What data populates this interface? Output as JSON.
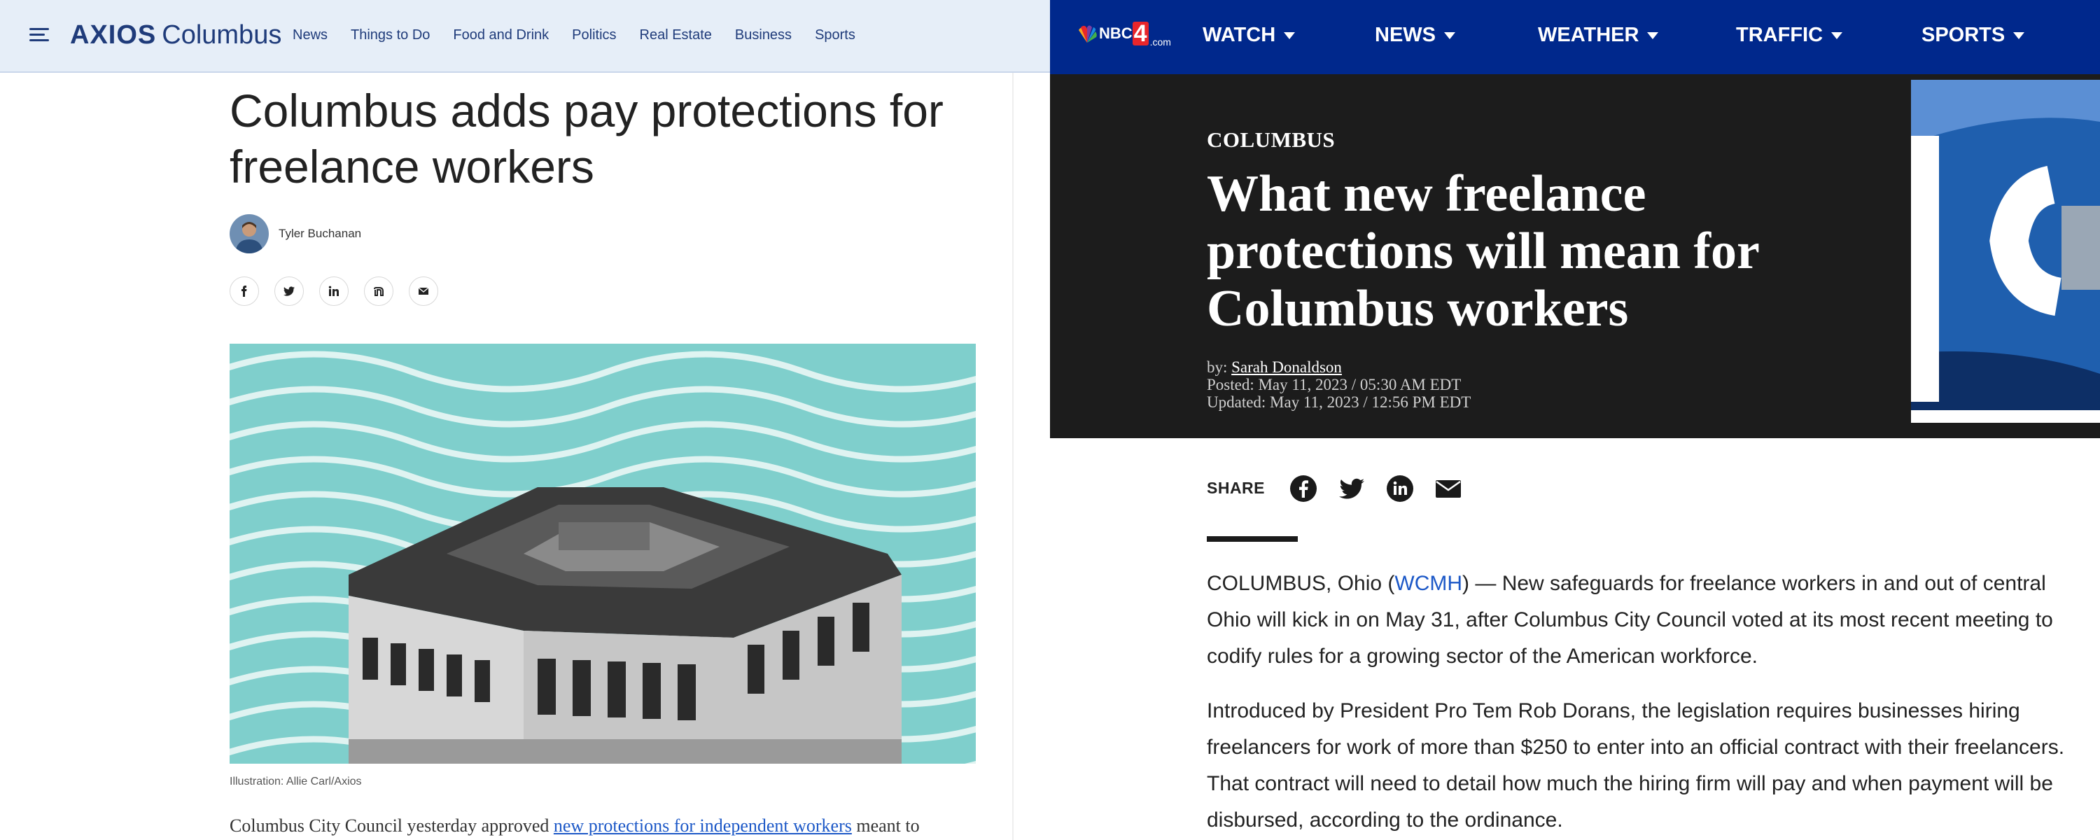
{
  "axios": {
    "logo_brand": "AXIOS",
    "logo_city": "Columbus",
    "nav": [
      "News",
      "Things to Do",
      "Food and Drink",
      "Politics",
      "Real Estate",
      "Business",
      "Sports"
    ],
    "title": "Columbus adds pay protections for freelance workers",
    "author": "Tyler Buchanan",
    "share_icons": [
      "facebook-icon",
      "twitter-icon",
      "linkedin-icon",
      "threads-icon",
      "email-icon"
    ],
    "caption": "Illustration: Allie Carl/Axios",
    "body_prefix": "Columbus City Council yesterday approved ",
    "body_link": "new protections for independent workers",
    "body_suffix": " meant to",
    "colors": {
      "header_bg": "#e6eef8",
      "brand": "#1f3b7a",
      "illustration_bg": "#7fcfcc"
    }
  },
  "nbc": {
    "logo_text": "NBC",
    "logo_number": "4",
    "logo_suffix": ".com",
    "nav": [
      "WATCH",
      "NEWS",
      "WEATHER",
      "TRAFFIC",
      "SPORTS"
    ],
    "section": "COLUMBUS",
    "title": "What new freelance protections will mean for Columbus workers",
    "byline_label": "by: ",
    "author": "Sarah Donaldson",
    "posted": "Posted: May 11, 2023 / 05:30 AM EDT",
    "updated": "Updated: May 11, 2023 / 12:56 PM EDT",
    "share_label": "SHARE",
    "share_icons": [
      "facebook-icon",
      "twitter-icon",
      "linkedin-icon",
      "email-icon"
    ],
    "para1_prefix": "COLUMBUS, Ohio (",
    "para1_link": "WCMH",
    "para1_suffix": ") — New safeguards for freelance workers in and out of central Ohio will kick in on May 31, after Columbus City Council voted at its most recent meeting to codify rules for a growing sector of the American workforce.",
    "para2": "Introduced by President Pro Tem Rob Dorans, the legislation requires businesses hiring freelancers for work of more than $250 to enter into an official contract with their freelancers. That contract will need to detail how much the hiring firm will pay and when payment will be disbursed, according to the ordinance.",
    "colors": {
      "nav_bg": "#00288c",
      "hero_bg": "#1c1c1c",
      "link": "#1c58c7"
    }
  }
}
